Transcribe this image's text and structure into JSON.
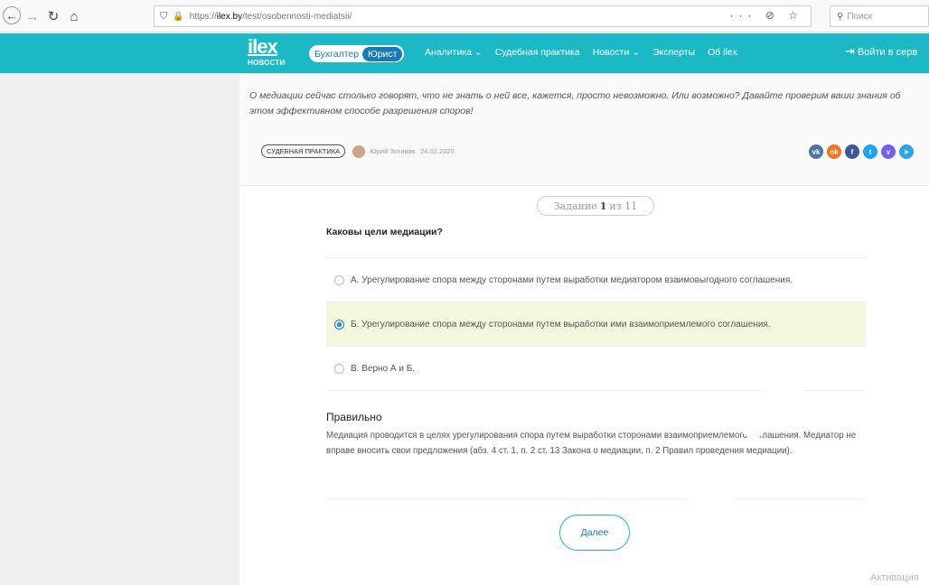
{
  "browser": {
    "url_prefix": "https://",
    "url_host": "ilex.by",
    "url_path": "/test/osobennosti-mediatsii/",
    "url_actions": "··· ⊘ ☆",
    "search_placeholder": "Поиск"
  },
  "header": {
    "logo_top": "ilex",
    "logo_bottom": "НОВОСТИ",
    "role_accountant": "Бухгалтер",
    "role_lawyer": "Юрист",
    "nav": [
      "Аналитика ⌄",
      "Судебная практика",
      "Новости ⌄",
      "Эксперты",
      "Об ilex"
    ],
    "login": "Войти в серв"
  },
  "article": {
    "lead": "О медиации сейчас столько говорят, что не знать о ней все, кажется, просто невозможно. Или возможно? Давайте проверим ваши знания об этом эффективном способе разрешения споров!",
    "tag": "СУДЕБНАЯ ПРАКТИКА",
    "author": "Юрий Зятиков",
    "date": "24.02.2020",
    "socials": [
      {
        "name": "vk-icon",
        "glyph": "vk",
        "color": "#4c75a3"
      },
      {
        "name": "odnoklassniki-icon",
        "glyph": "ok",
        "color": "#f4731c"
      },
      {
        "name": "facebook-icon",
        "glyph": "f",
        "color": "#3b5998"
      },
      {
        "name": "twitter-icon",
        "glyph": "t",
        "color": "#1da1f2"
      },
      {
        "name": "viber-icon",
        "glyph": "v",
        "color": "#7360f2"
      },
      {
        "name": "telegram-icon",
        "glyph": "➤",
        "color": "#2ca5e0"
      }
    ]
  },
  "quiz": {
    "task_prefix": "Задание",
    "task_current": "1",
    "task_mid": "из",
    "task_total": "11",
    "question": "Каковы цели медиации?",
    "answers": [
      {
        "label": "А. Урегулирование спора между сторонами путем выработки медиатором взаимовыгодного соглашения.",
        "selected": false
      },
      {
        "label": "Б. Урегулирование спора между сторонами путем выработки ими взаимоприемлемого соглашения.",
        "selected": true
      },
      {
        "label": "В. Верно А и Б.",
        "selected": false
      }
    ],
    "result_title": "Правильно",
    "result_text": "Медиация проводится в целях урегулирования спора путем выработки сторонами взаимоприемлемого соглашения. Медиатор не вправе вносить свои предложения (абз. 4 ст. 1, п. 2 ст. 13 Закона о медиации, п. 2 Правил проведения медиации).",
    "next_label": "Далее"
  },
  "os": {
    "activation": "Активация"
  }
}
